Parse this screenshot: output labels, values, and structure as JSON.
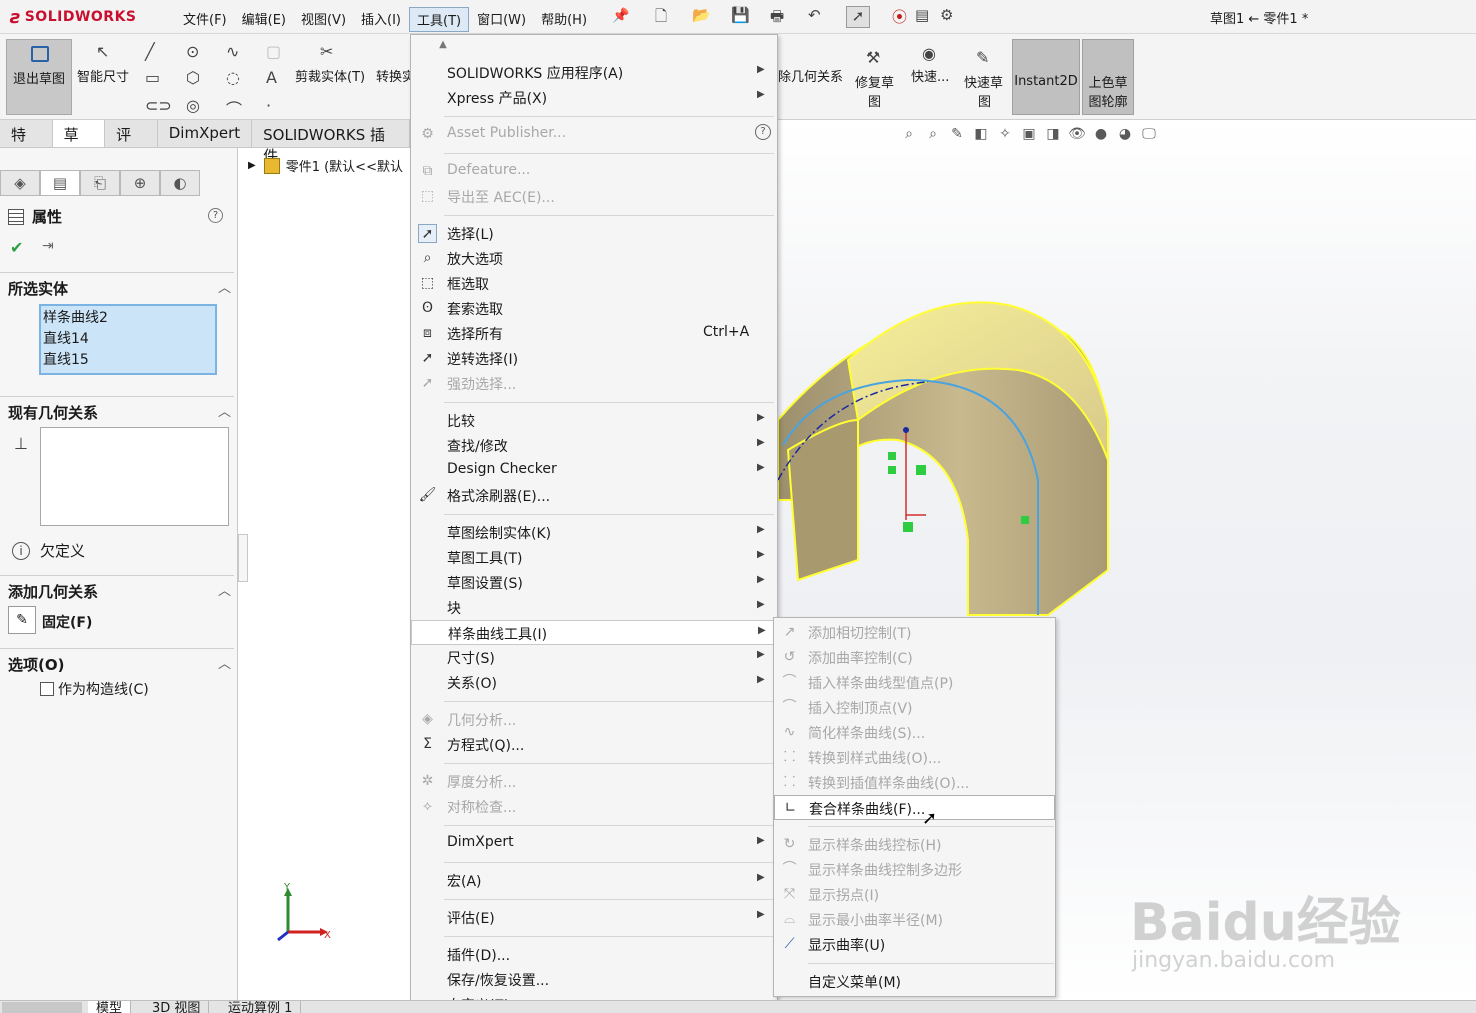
{
  "app": {
    "brand": "SOLIDWORKS",
    "doc_title": "草图1 ← 零件1 *"
  },
  "menubar": [
    "文件(F)",
    "编辑(E)",
    "视图(V)",
    "插入(I)",
    "工具(T)",
    "窗口(W)",
    "帮助(H)"
  ],
  "commandmanager": {
    "exit_sketch": "退出草图",
    "smart_dim": "智能尺寸",
    "trim": "剪裁实体(T)",
    "convert": "转换实",
    "del_geo": "除几何关系",
    "repair_line1": "修复草",
    "repair_line2": "图",
    "quick": "快速...",
    "quick_sketch_line1": "快速草",
    "quick_sketch_line2": "图",
    "instant2d": "Instant2D",
    "shade_line1": "上色草",
    "shade_line2": "图轮廓"
  },
  "tabs": [
    "特征",
    "草图",
    "评估",
    "DimXpert",
    "SOLIDWORKS 插件"
  ],
  "propertymanager": {
    "title": "属性",
    "selected_section": "所选实体",
    "selected_items": [
      "样条曲线2",
      "直线14",
      "直线15"
    ],
    "existing_section": "现有几何关系",
    "underdefined": "欠定义",
    "add_section": "添加几何关系",
    "fix_label": "固定(F)",
    "options_section": "选项(O)",
    "construction": "作为构造线(C)"
  },
  "tree": {
    "root": "零件1  (默认<<默认"
  },
  "tools_menu": {
    "items": [
      {
        "label": "SOLIDWORKS 应用程序(A)",
        "submenu": true
      },
      {
        "label": "Xpress 产品(X)",
        "submenu": true
      },
      {
        "label": "Asset Publisher...",
        "disabled": true
      },
      {
        "label": "Defeature...",
        "disabled": true
      },
      {
        "label": "导出至 AEC(E)...",
        "disabled": true
      },
      {
        "label": "选择(L)",
        "checked": true
      },
      {
        "label": "放大选项"
      },
      {
        "label": "框选取"
      },
      {
        "label": "套索选取"
      },
      {
        "label": "选择所有",
        "shortcut": "Ctrl+A"
      },
      {
        "label": "逆转选择(I)"
      },
      {
        "label": "强劲选择...",
        "disabled": true
      },
      {
        "label": "比较",
        "submenu": true
      },
      {
        "label": "查找/修改",
        "submenu": true
      },
      {
        "label": "Design Checker",
        "submenu": true
      },
      {
        "label": "格式涂刷器(E)..."
      },
      {
        "label": "草图绘制实体(K)",
        "submenu": true
      },
      {
        "label": "草图工具(T)",
        "submenu": true
      },
      {
        "label": "草图设置(S)",
        "submenu": true
      },
      {
        "label": "块",
        "submenu": true
      },
      {
        "label": "样条曲线工具(I)",
        "submenu": true
      },
      {
        "label": "尺寸(S)",
        "submenu": true
      },
      {
        "label": "关系(O)",
        "submenu": true
      },
      {
        "label": "几何分析...",
        "disabled": true
      },
      {
        "label": "方程式(Q)..."
      },
      {
        "label": "厚度分析...",
        "disabled": true
      },
      {
        "label": "对称检查...",
        "disabled": true
      },
      {
        "label": "DimXpert",
        "submenu": true
      },
      {
        "label": "宏(A)",
        "submenu": true
      },
      {
        "label": "评估(E)",
        "submenu": true
      },
      {
        "label": "插件(D)..."
      },
      {
        "label": "保存/恢复设置..."
      },
      {
        "label": "自定义(Z)..."
      }
    ]
  },
  "spline_submenu": {
    "items": [
      {
        "label": "添加相切控制(T)",
        "disabled": true
      },
      {
        "label": "添加曲率控制(C)",
        "disabled": true
      },
      {
        "label": "插入样条曲线型值点(P)",
        "disabled": true
      },
      {
        "label": "插入控制顶点(V)",
        "disabled": true
      },
      {
        "label": "简化样条曲线(S)...",
        "disabled": true
      },
      {
        "label": "转换到样式曲线(O)...",
        "disabled": true
      },
      {
        "label": "转换到插值样条曲线(O)...",
        "disabled": true
      },
      {
        "label": "套合样条曲线(F)...",
        "highlighted": true
      },
      {
        "label": "显示样条曲线控标(H)",
        "disabled": true
      },
      {
        "label": "显示样条曲线控制多边形",
        "disabled": true
      },
      {
        "label": "显示拐点(I)",
        "disabled": true
      },
      {
        "label": "显示最小曲率半径(M)",
        "disabled": true
      },
      {
        "label": "显示曲率(U)"
      },
      {
        "label": "自定义菜单(M)"
      }
    ]
  },
  "bottom_tabs": [
    "模型",
    "3D 视图",
    "运动算例 1"
  ],
  "triad": {
    "x": "X",
    "y": "Y"
  },
  "watermark": {
    "main": "Baidu经验",
    "sub": "jingyan.baidu.com"
  },
  "colors": {
    "part_face": "#bfae86",
    "highlight_edge": "#ffff33",
    "spline": "#4aa3e0",
    "menu_bg": "#f5f5f5"
  }
}
